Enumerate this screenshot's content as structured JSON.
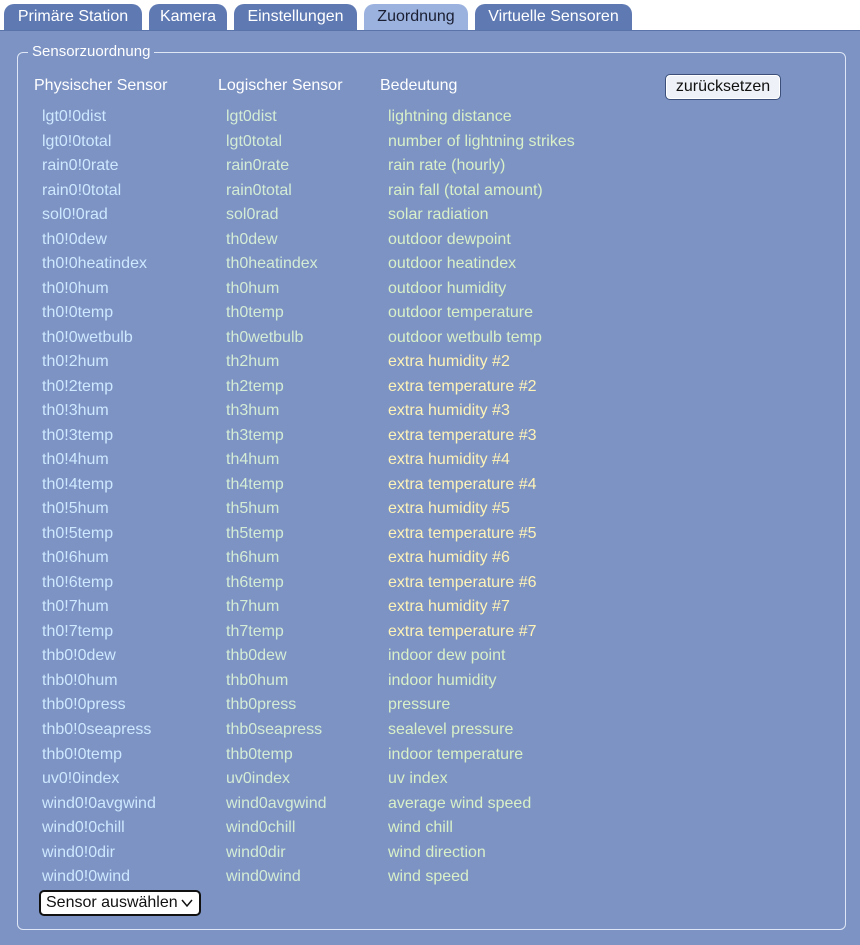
{
  "tabs": [
    {
      "label": "Primäre Station",
      "active": false
    },
    {
      "label": "Kamera",
      "active": false
    },
    {
      "label": "Einstellungen",
      "active": false
    },
    {
      "label": "Zuordnung",
      "active": true
    },
    {
      "label": "Virtuelle Sensoren",
      "active": false
    }
  ],
  "section": {
    "legend": "Sensorzuordnung",
    "headers": {
      "physical": "Physischer Sensor",
      "logical": "Logischer Sensor",
      "meaning": "Bedeutung"
    },
    "reset_label": "zurücksetzen",
    "select_value": "Sensor auswählen",
    "select_icon": "chevron-down-icon"
  },
  "colors": {
    "background": "#7c93c3",
    "tab": "#5f7ab3",
    "tab_active": "#9cb2de",
    "physical_text": "#cde8ff",
    "logical_text": "#d4ecd6",
    "meaning_text": "#d9f0c9",
    "extra_text": "#fff3b8"
  },
  "rows": [
    {
      "physical": "lgt0!0dist",
      "logical": "lgt0dist",
      "meaning": "lightning distance"
    },
    {
      "physical": "lgt0!0total",
      "logical": "lgt0total",
      "meaning": "number of lightning strikes"
    },
    {
      "physical": "rain0!0rate",
      "logical": "rain0rate",
      "meaning": "rain rate (hourly)"
    },
    {
      "physical": "rain0!0total",
      "logical": "rain0total",
      "meaning": "rain fall (total amount)"
    },
    {
      "physical": "sol0!0rad",
      "logical": "sol0rad",
      "meaning": "solar radiation"
    },
    {
      "physical": "th0!0dew",
      "logical": "th0dew",
      "meaning": "outdoor dewpoint"
    },
    {
      "physical": "th0!0heatindex",
      "logical": "th0heatindex",
      "meaning": "outdoor heatindex"
    },
    {
      "physical": "th0!0hum",
      "logical": "th0hum",
      "meaning": "outdoor humidity"
    },
    {
      "physical": "th0!0temp",
      "logical": "th0temp",
      "meaning": "outdoor temperature"
    },
    {
      "physical": "th0!0wetbulb",
      "logical": "th0wetbulb",
      "meaning": "outdoor wetbulb temp"
    },
    {
      "physical": "th0!2hum",
      "logical": "th2hum",
      "meaning": "extra humidity #2"
    },
    {
      "physical": "th0!2temp",
      "logical": "th2temp",
      "meaning": "extra temperature #2"
    },
    {
      "physical": "th0!3hum",
      "logical": "th3hum",
      "meaning": "extra humidity #3"
    },
    {
      "physical": "th0!3temp",
      "logical": "th3temp",
      "meaning": "extra temperature #3"
    },
    {
      "physical": "th0!4hum",
      "logical": "th4hum",
      "meaning": "extra humidity #4"
    },
    {
      "physical": "th0!4temp",
      "logical": "th4temp",
      "meaning": "extra temperature #4"
    },
    {
      "physical": "th0!5hum",
      "logical": "th5hum",
      "meaning": "extra humidity #5"
    },
    {
      "physical": "th0!5temp",
      "logical": "th5temp",
      "meaning": "extra temperature #5"
    },
    {
      "physical": "th0!6hum",
      "logical": "th6hum",
      "meaning": "extra humidity #6"
    },
    {
      "physical": "th0!6temp",
      "logical": "th6temp",
      "meaning": "extra temperature #6"
    },
    {
      "physical": "th0!7hum",
      "logical": "th7hum",
      "meaning": "extra humidity #7"
    },
    {
      "physical": "th0!7temp",
      "logical": "th7temp",
      "meaning": "extra temperature #7"
    },
    {
      "physical": "thb0!0dew",
      "logical": "thb0dew",
      "meaning": "indoor dew point"
    },
    {
      "physical": "thb0!0hum",
      "logical": "thb0hum",
      "meaning": "indoor humidity"
    },
    {
      "physical": "thb0!0press",
      "logical": "thb0press",
      "meaning": "pressure"
    },
    {
      "physical": "thb0!0seapress",
      "logical": "thb0seapress",
      "meaning": "sealevel pressure"
    },
    {
      "physical": "thb0!0temp",
      "logical": "thb0temp",
      "meaning": "indoor temperature"
    },
    {
      "physical": "uv0!0index",
      "logical": "uv0index",
      "meaning": "uv index"
    },
    {
      "physical": "wind0!0avgwind",
      "logical": "wind0avgwind",
      "meaning": "average wind speed"
    },
    {
      "physical": "wind0!0chill",
      "logical": "wind0chill",
      "meaning": "wind chill"
    },
    {
      "physical": "wind0!0dir",
      "logical": "wind0dir",
      "meaning": "wind direction"
    },
    {
      "physical": "wind0!0wind",
      "logical": "wind0wind",
      "meaning": "wind speed"
    }
  ]
}
